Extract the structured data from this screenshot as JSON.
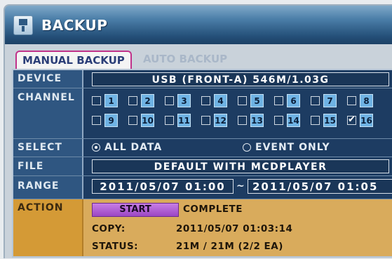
{
  "window": {
    "title": "BACKUP"
  },
  "tabs": [
    {
      "label": "MANUAL BACKUP",
      "active": true
    },
    {
      "label": "AUTO BACKUP",
      "active": false
    }
  ],
  "device": {
    "label": "DEVICE",
    "value": "USB (FRONT-A) 546M/1.03G"
  },
  "channel": {
    "label": "CHANNEL",
    "channels": [
      {
        "num": "1",
        "checked": false
      },
      {
        "num": "2",
        "checked": false
      },
      {
        "num": "3",
        "checked": false
      },
      {
        "num": "4",
        "checked": false
      },
      {
        "num": "5",
        "checked": false
      },
      {
        "num": "6",
        "checked": false
      },
      {
        "num": "7",
        "checked": false
      },
      {
        "num": "8",
        "checked": false
      },
      {
        "num": "9",
        "checked": false
      },
      {
        "num": "10",
        "checked": false
      },
      {
        "num": "11",
        "checked": false
      },
      {
        "num": "12",
        "checked": false
      },
      {
        "num": "13",
        "checked": false
      },
      {
        "num": "14",
        "checked": false
      },
      {
        "num": "15",
        "checked": false
      },
      {
        "num": "16",
        "checked": true
      }
    ]
  },
  "select": {
    "label": "SELECT",
    "options": [
      "ALL DATA",
      "EVENT ONLY"
    ],
    "selected": "ALL DATA"
  },
  "file": {
    "label": "FILE",
    "value": "DEFAULT WITH MCDPLAYER"
  },
  "range": {
    "label": "RANGE",
    "start": "2011/05/07 01:00",
    "separator": "~",
    "end": "2011/05/07 01:05"
  },
  "action": {
    "label": "ACTION",
    "start_button": "START",
    "status_text": "COMPLETE",
    "copy_label": "COPY:",
    "copy_value": "2011/05/07 01:03:14",
    "status_label": "STATUS:",
    "status_value": "21M / 21M (2/2 EA)"
  },
  "colors": {
    "titlebar": "#244f78",
    "panel": "#1d3c62",
    "action_bg": "#d9ab5c",
    "start_button": "#9b46c3",
    "channel_number": "#6fb3e4",
    "active_tab_border": "#c0328a"
  }
}
